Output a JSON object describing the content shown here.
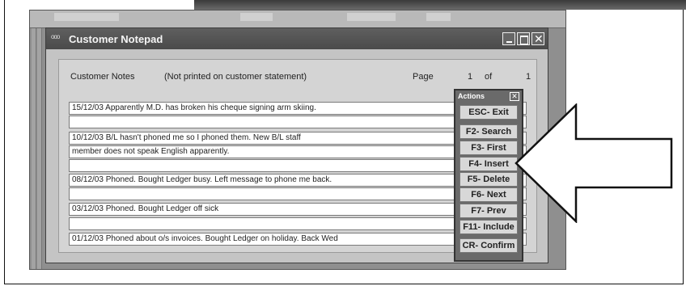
{
  "window": {
    "icon_text": "ooo",
    "title": "Customer Notepad",
    "minimize_glyph": "",
    "maximize_glyph": "",
    "close_glyph": "✕"
  },
  "header": {
    "notes_label": "Customer Notes",
    "not_printed": "(Not printed on customer statement)",
    "page_label": "Page",
    "page_number": "1",
    "of_label": "of",
    "page_total": "1"
  },
  "lines": [
    "15/12/03 Apparently M.D. has broken his cheque signing arm skiing.",
    "",
    "10/12/03 B/L hasn't phoned me so I phoned them. New B/L staff",
    "member does not speak English apparently.",
    "",
    "08/12/03 Phoned. Bought Ledger busy. Left message to phone me back.",
    "",
    "03/12/03 Phoned. Bought Ledger off sick",
    "",
    "01/12/03 Phoned about o/s invoices. Bought Ledger on holiday. Back Wed"
  ],
  "actions": {
    "title": "Actions",
    "close_label": "✕",
    "buttons": [
      "ESC- Exit",
      "F2- Search",
      "F3- First",
      "F4- Insert",
      "F5- Delete",
      "F6- Next",
      "F7- Prev",
      "F11- Include",
      "CR- Confirm"
    ]
  },
  "colors": {
    "titlebar": "#4a4a4a",
    "window_bg": "#c4c4c4",
    "actions_bg": "#6a6a6a",
    "arrow_stroke": "#111111"
  }
}
